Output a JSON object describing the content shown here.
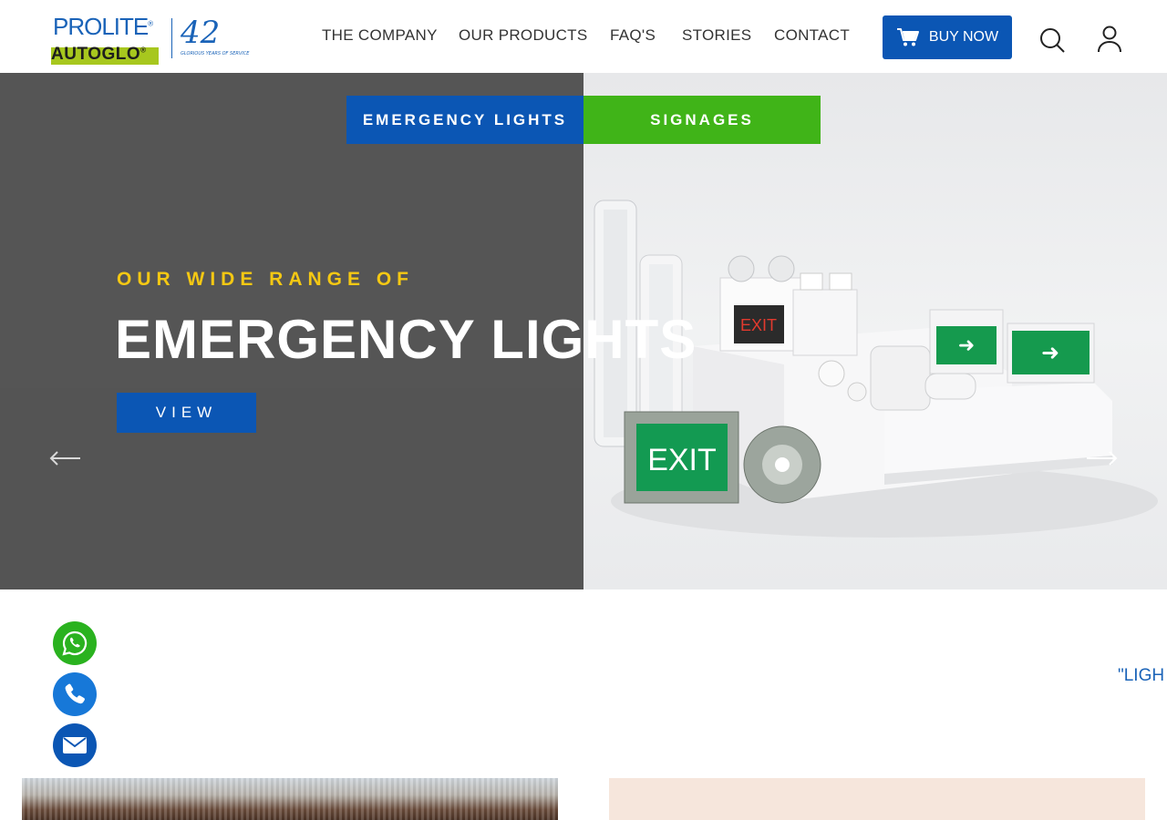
{
  "header": {
    "logo": {
      "brand_line1": "PROLITE",
      "brand_line2": "AUTOGLO",
      "years": "42",
      "tagline": "GLORIOUS YEARS OF SERVICE"
    },
    "nav": [
      {
        "label": "THE COMPANY"
      },
      {
        "label": "OUR PRODUCTS"
      },
      {
        "label": "FAQ'S"
      },
      {
        "label": "STORIES"
      },
      {
        "label": "CONTACT"
      }
    ],
    "buy_now_label": "BUY NOW",
    "icons": {
      "cart": "cart-icon",
      "search": "search-icon",
      "user": "user-icon"
    }
  },
  "hero": {
    "tabs": [
      {
        "label": "EMERGENCY LIGHTS"
      },
      {
        "label": "SIGNAGES"
      }
    ],
    "subheadline": "OUR WIDE RANGE OF",
    "headline": "EMERGENCY LIGHTS",
    "view_label": "VIEW",
    "product_signs": {
      "exit_red": "EXIT",
      "exit_green": "EXIT"
    }
  },
  "marquee_text": "\"LIGH",
  "floating": [
    "whatsapp-icon",
    "phone-icon",
    "mail-icon"
  ],
  "colors": {
    "primary_blue": "#0b56b4",
    "green": "#40b418",
    "yellow": "#f4c813",
    "hero_gray": "#555555"
  }
}
